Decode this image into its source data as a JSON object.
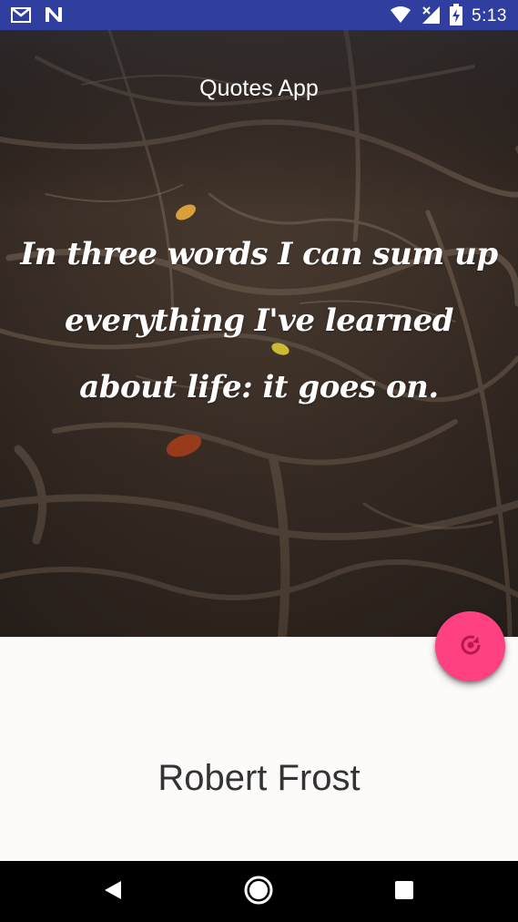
{
  "status_bar": {
    "time": "5:13",
    "icons": [
      "gmail-icon",
      "n-notification-icon",
      "wifi-icon",
      "cell-signal-off-icon",
      "battery-charging-icon"
    ],
    "background": "#303f9f"
  },
  "header": {
    "title": "Quotes App"
  },
  "quote": {
    "text": "In three words I can sum up everything I've learned about life: it goes on."
  },
  "author": {
    "name": "Robert Frost"
  },
  "fab": {
    "icon": "refresh-icon",
    "color": "#ff4081"
  },
  "nav_bar": {
    "buttons": [
      "back-icon",
      "home-icon",
      "recents-icon"
    ]
  }
}
